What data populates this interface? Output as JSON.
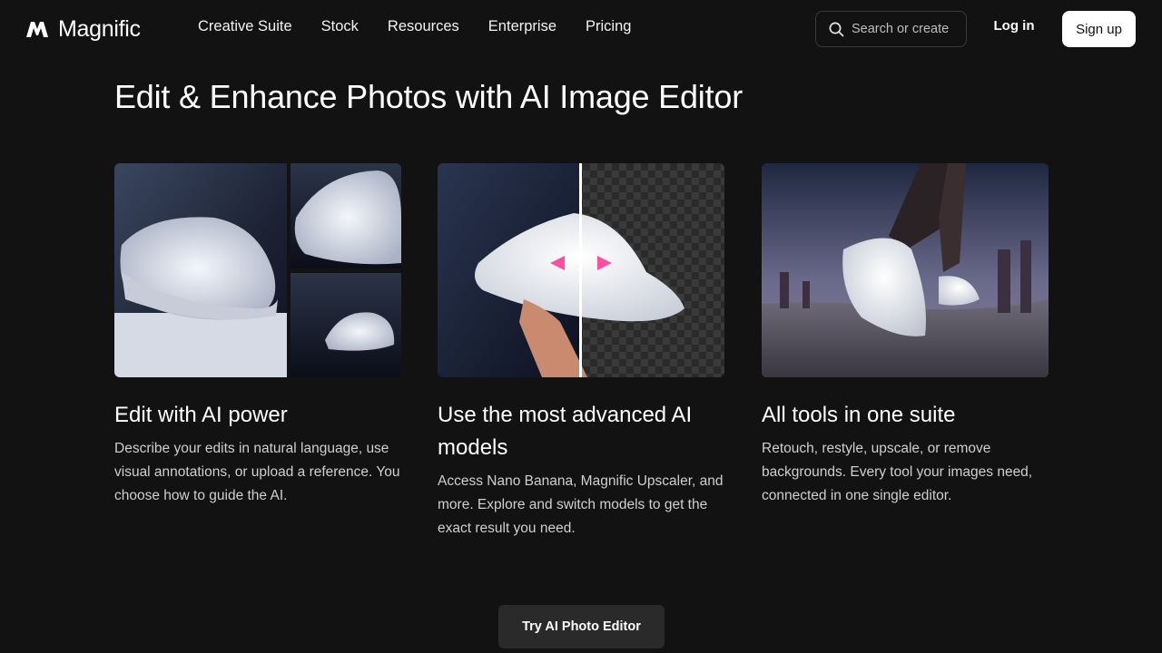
{
  "header": {
    "logo_text": "Magnific",
    "nav": [
      "Creative Suite",
      "Stock",
      "Resources",
      "Enterprise",
      "Pricing"
    ],
    "search_placeholder": "Search or create",
    "login_label": "Log in",
    "signup_label": "Sign up"
  },
  "main": {
    "title": "Edit & Enhance Photos with AI Image Editor",
    "cards": [
      {
        "title": "Edit with AI power",
        "description": "Describe your edits in natural language, use visual annotations, or upload a reference. You choose how to guide the AI."
      },
      {
        "title": "Use the most advanced AI models",
        "description": "Access Nano Banana, Magnific Upscaler, and more. Explore and switch models to get the exact result you need."
      },
      {
        "title": "All tools in one suite",
        "description": "Retouch, restyle, upscale, or remove backgrounds. Every tool your images need, connected in one single editor."
      }
    ],
    "cta_label": "Try AI Photo Editor"
  },
  "colors": {
    "background": "#121212",
    "accent_arrow": "#ff4fa3",
    "button_bg": "#ffffff"
  }
}
